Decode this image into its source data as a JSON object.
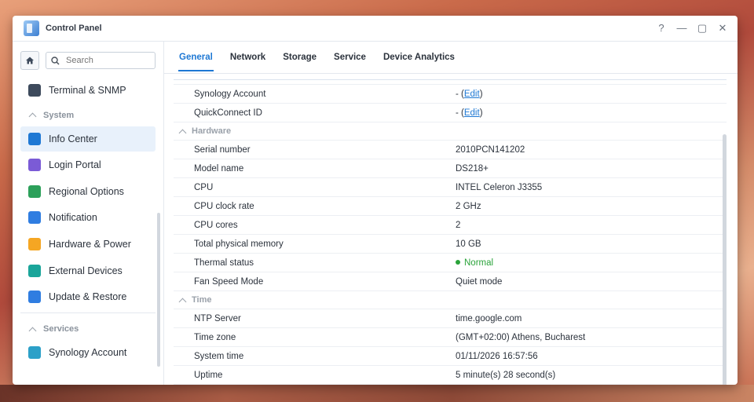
{
  "window": {
    "title": "Control Panel",
    "controls": [
      "?",
      "—",
      "▢",
      "✕"
    ]
  },
  "sidebar": {
    "search_placeholder": "Search",
    "items": [
      {
        "type": "item",
        "label": "Terminal & SNMP",
        "icon": "terminal-icon",
        "color": "#3d4a5c"
      },
      {
        "type": "head",
        "label": "System"
      },
      {
        "type": "item",
        "label": "Info Center",
        "icon": "info-icon",
        "color": "#1e78d4",
        "active": true
      },
      {
        "type": "item",
        "label": "Login Portal",
        "icon": "login-portal-icon",
        "color": "#7b5bd6"
      },
      {
        "type": "item",
        "label": "Regional Options",
        "icon": "regional-options-icon",
        "color": "#2ca05a"
      },
      {
        "type": "item",
        "label": "Notification",
        "icon": "notification-icon",
        "color": "#2f7de1"
      },
      {
        "type": "item",
        "label": "Hardware & Power",
        "icon": "lightbulb-icon",
        "color": "#f5a623"
      },
      {
        "type": "item",
        "label": "External Devices",
        "icon": "external-device-icon",
        "color": "#1aa59a"
      },
      {
        "type": "item",
        "label": "Update & Restore",
        "icon": "update-icon",
        "color": "#2f7de1"
      },
      {
        "type": "head",
        "label": "Services"
      },
      {
        "type": "item",
        "label": "Synology Account",
        "icon": "synology-account-icon",
        "color": "#2ca0c8"
      }
    ]
  },
  "tabs": [
    "General",
    "Network",
    "Storage",
    "Service",
    "Device Analytics"
  ],
  "rows": [
    {
      "type": "row",
      "key": "Synology Account",
      "value": "- (",
      "link": "Edit",
      "suffix": ")"
    },
    {
      "type": "row",
      "key": "QuickConnect ID",
      "value": "- (",
      "link": "Edit",
      "suffix": ")"
    },
    {
      "type": "sec",
      "label": "Hardware"
    },
    {
      "type": "row",
      "key": "Serial number",
      "value": "2010PCN141202"
    },
    {
      "type": "row",
      "key": "Model name",
      "value": "DS218+"
    },
    {
      "type": "row",
      "key": "CPU",
      "value": "INTEL Celeron J3355"
    },
    {
      "type": "row",
      "key": "CPU clock rate",
      "value": "2 GHz"
    },
    {
      "type": "row",
      "key": "CPU cores",
      "value": "2"
    },
    {
      "type": "row",
      "key": "Total physical memory",
      "value": "10 GB"
    },
    {
      "type": "row",
      "key": "Thermal status",
      "value": "Normal",
      "status": true
    },
    {
      "type": "row",
      "key": "Fan Speed Mode",
      "value": "Quiet mode"
    },
    {
      "type": "sec",
      "label": "Time"
    },
    {
      "type": "row",
      "key": "NTP Server",
      "value": "time.google.com"
    },
    {
      "type": "row",
      "key": "Time zone",
      "value": "(GMT+02:00) Athens, Bucharest"
    },
    {
      "type": "row",
      "key": "System time",
      "value": "01/11/2026 16:57:56"
    },
    {
      "type": "row",
      "key": "Uptime",
      "value": "5 minute(s) 28 second(s)"
    }
  ]
}
